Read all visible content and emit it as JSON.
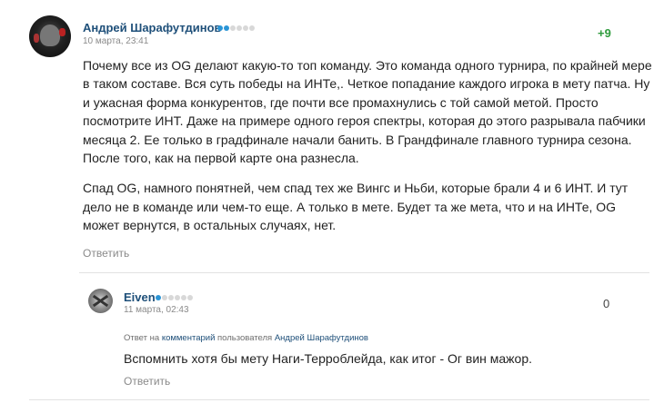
{
  "comment": {
    "author": "Андрей Шарафутдинов",
    "rank_level": 2,
    "rank_total": 6,
    "date": "10 марта, 23:41",
    "score": "+9",
    "paragraphs": [
      "Почему все из OG делают какую-то топ команду. Это команда одного турнира, по крайней мере в таком составе. Вся суть победы на ИНТе,. Четкое попадание каждого игрока в мету патча. Ну и ужасная форма конкурентов, где почти все промахнулись с той самой метой. Просто посмотрите ИНТ. Даже на примере одного героя спектры, которая до этого разрывала пабчики месяца 2. Ее только в градфинале начали банить. В Грандфинале главного турнира сезона. После того, как на первой карте она разнесла.",
      "Спад OG, намного понятней, чем спад тех же Вингс и Ньби, которые брали 4 и 6 ИНТ. И тут дело не в команде или чем-то еще. А только в мете. Будет та же мета, что и на ИНТе, OG может вернутся, в остальных случаях, нет."
    ],
    "reply_label": "Ответить",
    "avatar_icon": "user-avatar"
  },
  "reply": {
    "author": "Eiven",
    "rank_level": 1,
    "rank_total": 6,
    "date": "11 марта, 02:43",
    "score": "0",
    "reply_to_prefix": "Ответ на",
    "reply_to_link": "комментарий",
    "reply_to_mid": "пользователя",
    "reply_to_user": "Андрей Шарафутдинов",
    "text": "Вспомнить хотя бы мету Наги-Терроблейда, как итог - Ог вин мажор.",
    "reply_label": "Ответить",
    "avatar_icon": "user-avatar"
  },
  "colors": {
    "author": "#1e4f79",
    "positive_score": "#2e9b3c",
    "rank_on": "#2b95d6",
    "muted": "#8a8a8a"
  }
}
